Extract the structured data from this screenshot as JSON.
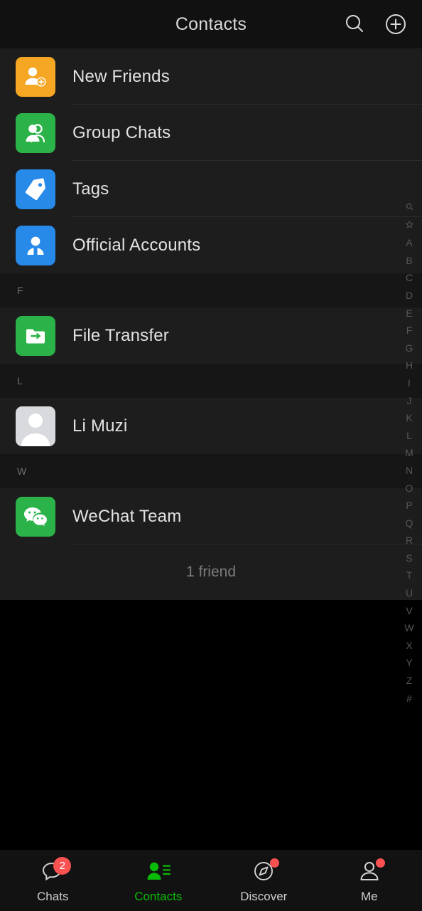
{
  "header": {
    "title": "Contacts",
    "search_icon": "search-icon",
    "add_icon": "add-circle-icon"
  },
  "list": {
    "entries": [
      {
        "kind": "row",
        "label": "New Friends",
        "icon": "new-friend-icon",
        "color": "#f5a623",
        "divider": true
      },
      {
        "kind": "row",
        "label": "Group Chats",
        "icon": "group-chat-icon",
        "color": "#2bb34a",
        "divider": true
      },
      {
        "kind": "row",
        "label": "Tags",
        "icon": "tag-icon",
        "color": "#2789e8",
        "divider": true
      },
      {
        "kind": "row",
        "label": "Official Accounts",
        "icon": "official-account-icon",
        "color": "#2789e8",
        "divider": false
      },
      {
        "kind": "section",
        "label": "F"
      },
      {
        "kind": "row",
        "label": "File Transfer",
        "icon": "file-transfer-icon",
        "color": "#2bb34a",
        "divider": false
      },
      {
        "kind": "section",
        "label": "L"
      },
      {
        "kind": "row",
        "label": "Li Muzi",
        "icon": "default-avatar-icon",
        "color": "#d8dade",
        "divider": false
      },
      {
        "kind": "section",
        "label": "W"
      },
      {
        "kind": "row",
        "label": "WeChat Team",
        "icon": "wechat-logo-icon",
        "color": "#2bb34a",
        "divider": true
      }
    ],
    "footer_count": "1 friend"
  },
  "index_rail": {
    "items": [
      {
        "type": "icon",
        "label": "search-icon"
      },
      {
        "type": "icon",
        "label": "star-icon"
      },
      {
        "type": "text",
        "label": "A"
      },
      {
        "type": "text",
        "label": "B"
      },
      {
        "type": "text",
        "label": "C"
      },
      {
        "type": "text",
        "label": "D"
      },
      {
        "type": "text",
        "label": "E"
      },
      {
        "type": "text",
        "label": "F"
      },
      {
        "type": "text",
        "label": "G"
      },
      {
        "type": "text",
        "label": "H"
      },
      {
        "type": "text",
        "label": "I"
      },
      {
        "type": "text",
        "label": "J"
      },
      {
        "type": "text",
        "label": "K"
      },
      {
        "type": "text",
        "label": "L"
      },
      {
        "type": "text",
        "label": "M"
      },
      {
        "type": "text",
        "label": "N"
      },
      {
        "type": "text",
        "label": "O"
      },
      {
        "type": "text",
        "label": "P"
      },
      {
        "type": "text",
        "label": "Q"
      },
      {
        "type": "text",
        "label": "R"
      },
      {
        "type": "text",
        "label": "S"
      },
      {
        "type": "text",
        "label": "T"
      },
      {
        "type": "text",
        "label": "U"
      },
      {
        "type": "text",
        "label": "V"
      },
      {
        "type": "text",
        "label": "W"
      },
      {
        "type": "text",
        "label": "X"
      },
      {
        "type": "text",
        "label": "Y"
      },
      {
        "type": "text",
        "label": "Z"
      },
      {
        "type": "text",
        "label": "#"
      }
    ]
  },
  "tabbar": {
    "tabs": [
      {
        "label": "Chats",
        "icon": "chat-bubble-icon",
        "badge": "2",
        "badge_type": "count",
        "active": false
      },
      {
        "label": "Contacts",
        "icon": "contacts-icon",
        "badge": "",
        "badge_type": "none",
        "active": true
      },
      {
        "label": "Discover",
        "icon": "compass-icon",
        "badge": "",
        "badge_type": "dot",
        "active": false
      },
      {
        "label": "Me",
        "icon": "person-icon",
        "badge": "",
        "badge_type": "dot",
        "active": false
      }
    ]
  },
  "colors": {
    "accent_green": "#09bb07",
    "badge_red": "#fa5151",
    "page_bg": "#000000",
    "row_bg": "#1d1d1d",
    "section_bg": "#161616"
  }
}
